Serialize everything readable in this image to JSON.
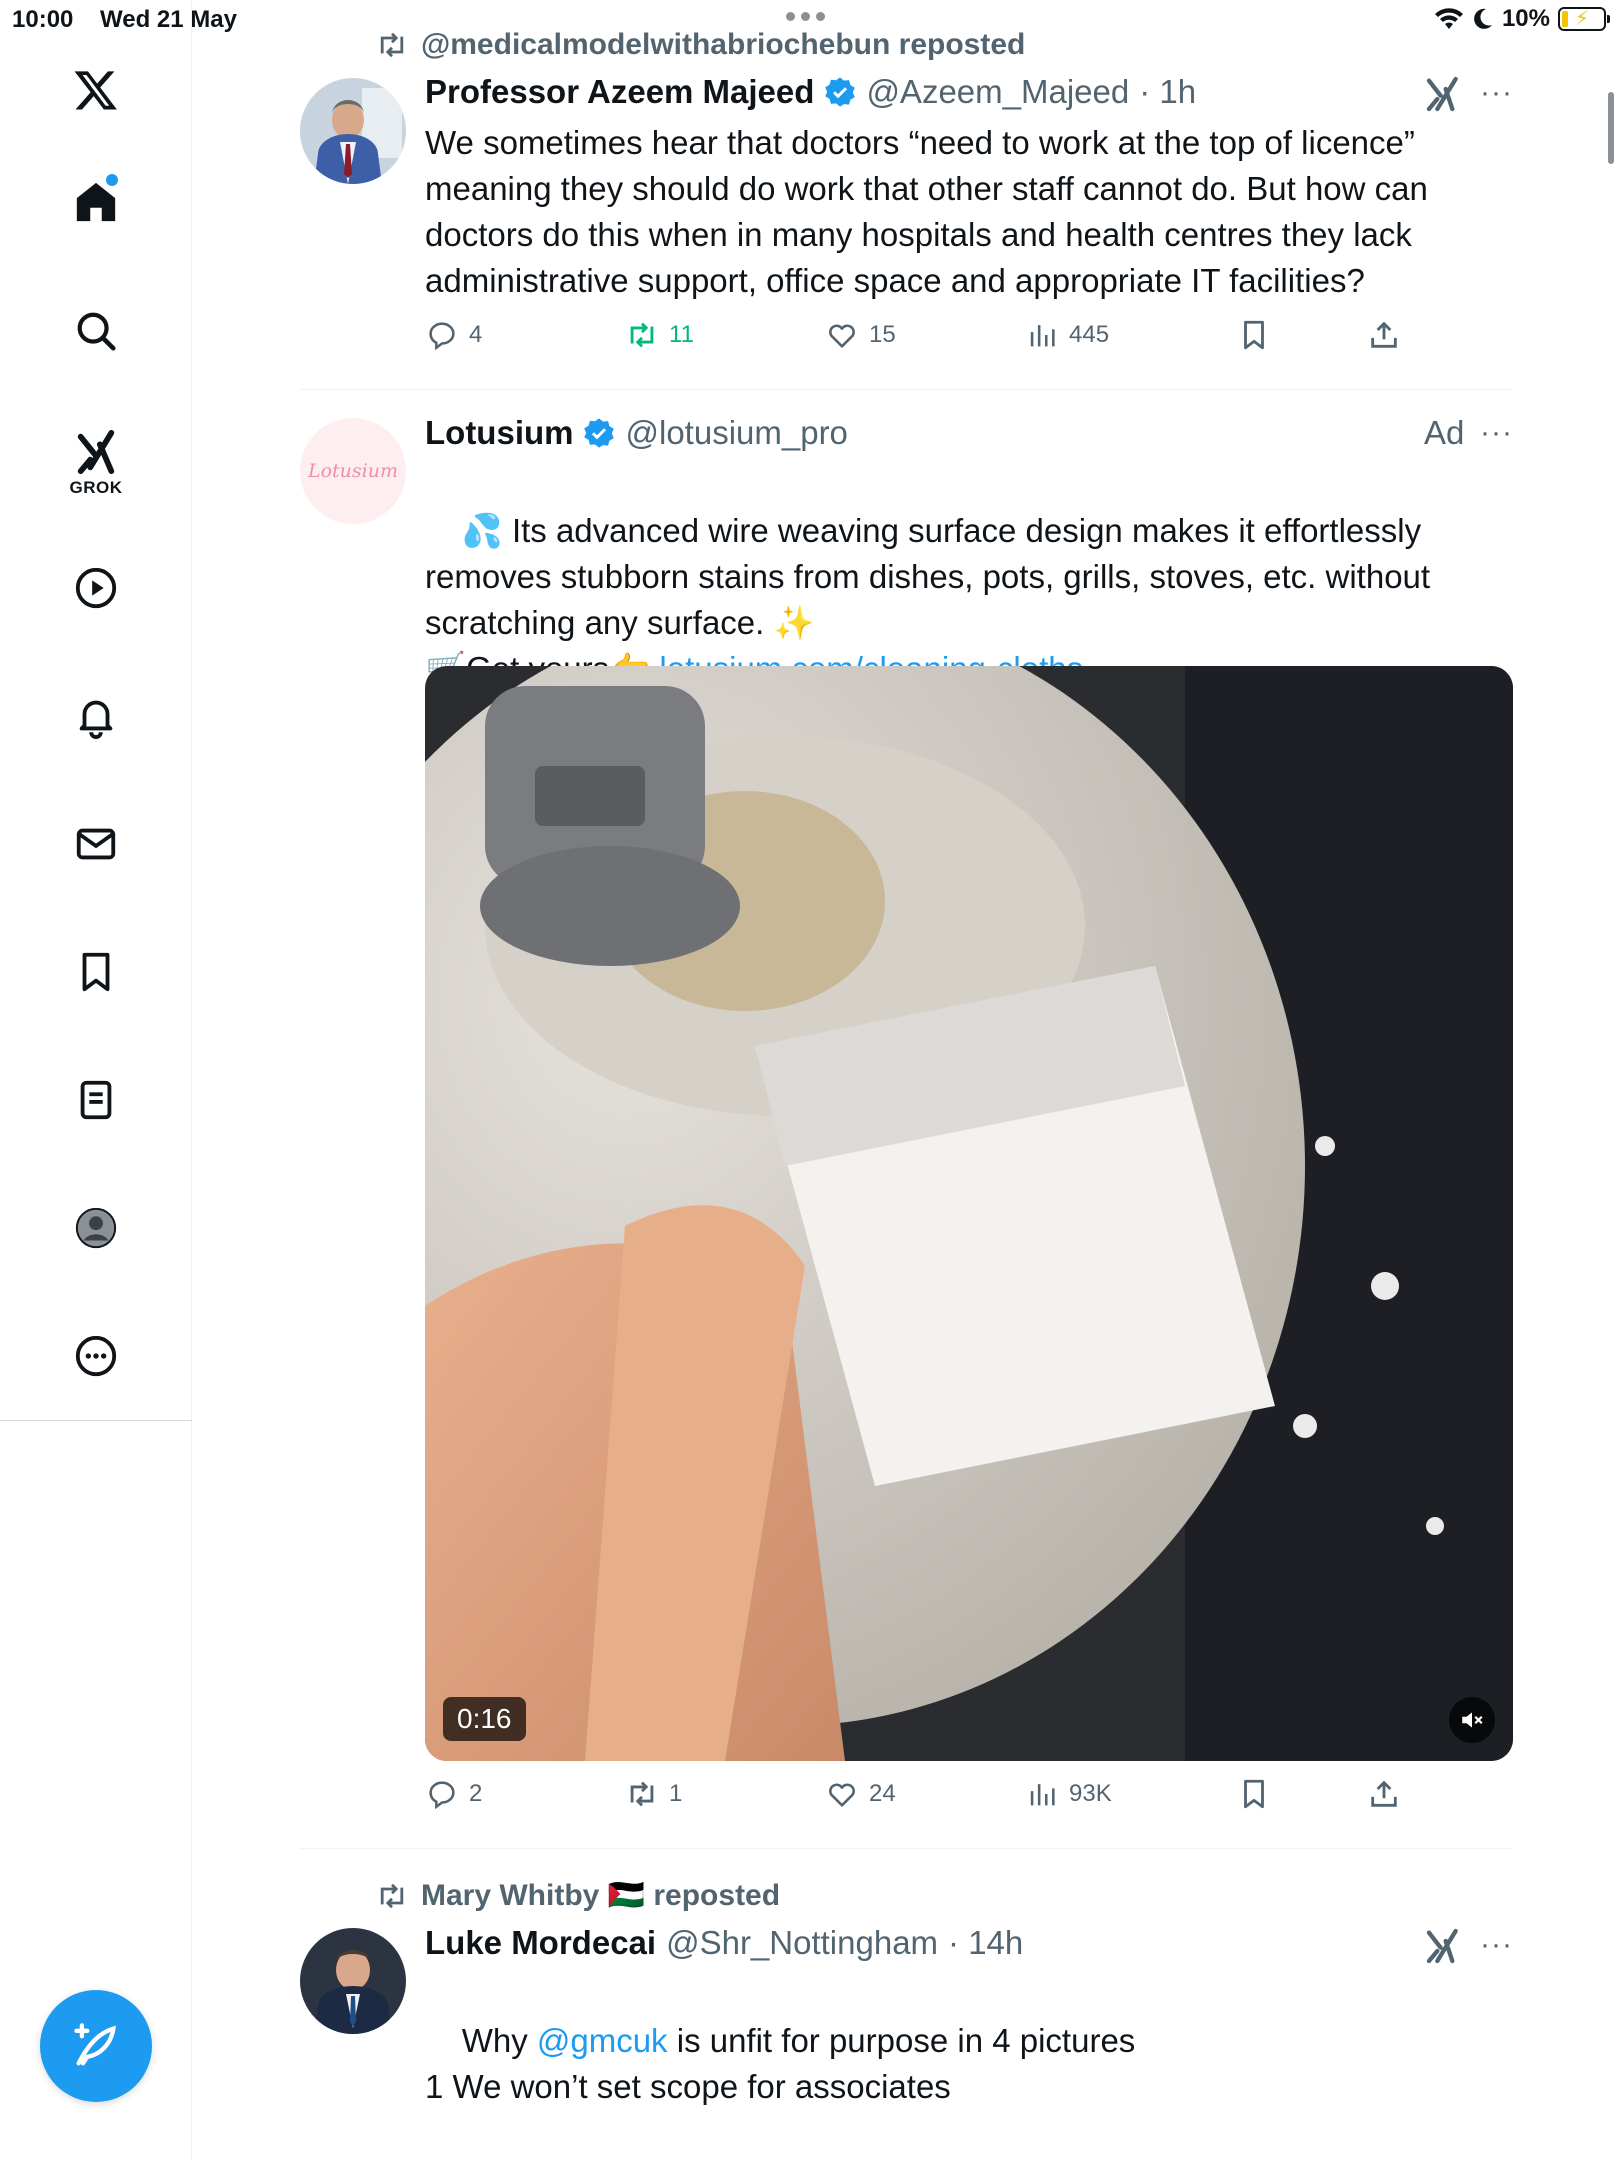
{
  "status_bar": {
    "time": "10:00",
    "date": "Wed 21 May",
    "battery": "10%"
  },
  "sidebar": {
    "grok_label": "GROK",
    "items": [
      "home",
      "explore",
      "grok",
      "videos",
      "notifications",
      "messages",
      "bookmarks",
      "lists",
      "profile",
      "more"
    ]
  },
  "tweets": [
    {
      "repost_by": "@medicalmodelwithabriochebun reposted",
      "name": "Professor Azeem Majeed",
      "handle": "@Azeem_Majeed",
      "time": "· 1h",
      "text": "We sometimes hear that doctors “need to work at the top of licence” meaning they should do work that other staff cannot do. But how can doctors do this when in many hospitals and health centres they lack administrative support, office space and appropriate IT facilities?",
      "replies": "4",
      "reposts": "11",
      "likes": "15",
      "views": "445"
    },
    {
      "name": "Lotusium",
      "handle": "@lotusium_pro",
      "ad_label": "Ad",
      "avatar_text": "Lotusium",
      "text_line1": "💦 Its advanced wire weaving surface design makes it effortlessly removes stubborn stains from dishes, pots, grills, stoves, etc. without scratching any surface. ✨",
      "text_line2_prefix": "🛒Get yours👉 ",
      "link": "lotusium.com/cleaning-cloths",
      "video_duration": "0:16",
      "replies": "2",
      "reposts": "1",
      "likes": "24",
      "views": "93K"
    },
    {
      "repost_by": "Mary Whitby 🇵🇸 reposted",
      "name": "Luke Mordecai",
      "handle": "@Shr_Nottingham",
      "time": "· 14h",
      "text_prefix": "Why ",
      "mention": "@gmcuk",
      "text_suffix": " is unfit for purpose in 4 pictures",
      "text_line2": "1 We won’t set scope for associates"
    }
  ],
  "colors": {
    "accent": "#1d9bf0",
    "repost_green": "#00ba7c",
    "muted": "#536471"
  }
}
